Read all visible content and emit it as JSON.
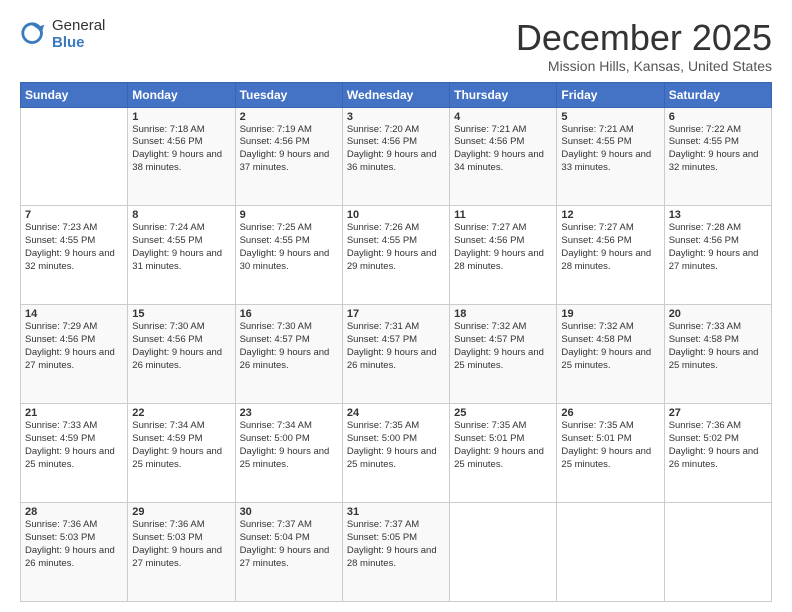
{
  "header": {
    "logo_general": "General",
    "logo_blue": "Blue",
    "month_title": "December 2025",
    "location": "Mission Hills, Kansas, United States"
  },
  "days_of_week": [
    "Sunday",
    "Monday",
    "Tuesday",
    "Wednesday",
    "Thursday",
    "Friday",
    "Saturday"
  ],
  "weeks": [
    [
      {
        "day": "",
        "sunrise": "",
        "sunset": "",
        "daylight": ""
      },
      {
        "day": "1",
        "sunrise": "Sunrise: 7:18 AM",
        "sunset": "Sunset: 4:56 PM",
        "daylight": "Daylight: 9 hours and 38 minutes."
      },
      {
        "day": "2",
        "sunrise": "Sunrise: 7:19 AM",
        "sunset": "Sunset: 4:56 PM",
        "daylight": "Daylight: 9 hours and 37 minutes."
      },
      {
        "day": "3",
        "sunrise": "Sunrise: 7:20 AM",
        "sunset": "Sunset: 4:56 PM",
        "daylight": "Daylight: 9 hours and 36 minutes."
      },
      {
        "day": "4",
        "sunrise": "Sunrise: 7:21 AM",
        "sunset": "Sunset: 4:56 PM",
        "daylight": "Daylight: 9 hours and 34 minutes."
      },
      {
        "day": "5",
        "sunrise": "Sunrise: 7:21 AM",
        "sunset": "Sunset: 4:55 PM",
        "daylight": "Daylight: 9 hours and 33 minutes."
      },
      {
        "day": "6",
        "sunrise": "Sunrise: 7:22 AM",
        "sunset": "Sunset: 4:55 PM",
        "daylight": "Daylight: 9 hours and 32 minutes."
      }
    ],
    [
      {
        "day": "7",
        "sunrise": "Sunrise: 7:23 AM",
        "sunset": "Sunset: 4:55 PM",
        "daylight": "Daylight: 9 hours and 32 minutes."
      },
      {
        "day": "8",
        "sunrise": "Sunrise: 7:24 AM",
        "sunset": "Sunset: 4:55 PM",
        "daylight": "Daylight: 9 hours and 31 minutes."
      },
      {
        "day": "9",
        "sunrise": "Sunrise: 7:25 AM",
        "sunset": "Sunset: 4:55 PM",
        "daylight": "Daylight: 9 hours and 30 minutes."
      },
      {
        "day": "10",
        "sunrise": "Sunrise: 7:26 AM",
        "sunset": "Sunset: 4:55 PM",
        "daylight": "Daylight: 9 hours and 29 minutes."
      },
      {
        "day": "11",
        "sunrise": "Sunrise: 7:27 AM",
        "sunset": "Sunset: 4:56 PM",
        "daylight": "Daylight: 9 hours and 28 minutes."
      },
      {
        "day": "12",
        "sunrise": "Sunrise: 7:27 AM",
        "sunset": "Sunset: 4:56 PM",
        "daylight": "Daylight: 9 hours and 28 minutes."
      },
      {
        "day": "13",
        "sunrise": "Sunrise: 7:28 AM",
        "sunset": "Sunset: 4:56 PM",
        "daylight": "Daylight: 9 hours and 27 minutes."
      }
    ],
    [
      {
        "day": "14",
        "sunrise": "Sunrise: 7:29 AM",
        "sunset": "Sunset: 4:56 PM",
        "daylight": "Daylight: 9 hours and 27 minutes."
      },
      {
        "day": "15",
        "sunrise": "Sunrise: 7:30 AM",
        "sunset": "Sunset: 4:56 PM",
        "daylight": "Daylight: 9 hours and 26 minutes."
      },
      {
        "day": "16",
        "sunrise": "Sunrise: 7:30 AM",
        "sunset": "Sunset: 4:57 PM",
        "daylight": "Daylight: 9 hours and 26 minutes."
      },
      {
        "day": "17",
        "sunrise": "Sunrise: 7:31 AM",
        "sunset": "Sunset: 4:57 PM",
        "daylight": "Daylight: 9 hours and 26 minutes."
      },
      {
        "day": "18",
        "sunrise": "Sunrise: 7:32 AM",
        "sunset": "Sunset: 4:57 PM",
        "daylight": "Daylight: 9 hours and 25 minutes."
      },
      {
        "day": "19",
        "sunrise": "Sunrise: 7:32 AM",
        "sunset": "Sunset: 4:58 PM",
        "daylight": "Daylight: 9 hours and 25 minutes."
      },
      {
        "day": "20",
        "sunrise": "Sunrise: 7:33 AM",
        "sunset": "Sunset: 4:58 PM",
        "daylight": "Daylight: 9 hours and 25 minutes."
      }
    ],
    [
      {
        "day": "21",
        "sunrise": "Sunrise: 7:33 AM",
        "sunset": "Sunset: 4:59 PM",
        "daylight": "Daylight: 9 hours and 25 minutes."
      },
      {
        "day": "22",
        "sunrise": "Sunrise: 7:34 AM",
        "sunset": "Sunset: 4:59 PM",
        "daylight": "Daylight: 9 hours and 25 minutes."
      },
      {
        "day": "23",
        "sunrise": "Sunrise: 7:34 AM",
        "sunset": "Sunset: 5:00 PM",
        "daylight": "Daylight: 9 hours and 25 minutes."
      },
      {
        "day": "24",
        "sunrise": "Sunrise: 7:35 AM",
        "sunset": "Sunset: 5:00 PM",
        "daylight": "Daylight: 9 hours and 25 minutes."
      },
      {
        "day": "25",
        "sunrise": "Sunrise: 7:35 AM",
        "sunset": "Sunset: 5:01 PM",
        "daylight": "Daylight: 9 hours and 25 minutes."
      },
      {
        "day": "26",
        "sunrise": "Sunrise: 7:35 AM",
        "sunset": "Sunset: 5:01 PM",
        "daylight": "Daylight: 9 hours and 25 minutes."
      },
      {
        "day": "27",
        "sunrise": "Sunrise: 7:36 AM",
        "sunset": "Sunset: 5:02 PM",
        "daylight": "Daylight: 9 hours and 26 minutes."
      }
    ],
    [
      {
        "day": "28",
        "sunrise": "Sunrise: 7:36 AM",
        "sunset": "Sunset: 5:03 PM",
        "daylight": "Daylight: 9 hours and 26 minutes."
      },
      {
        "day": "29",
        "sunrise": "Sunrise: 7:36 AM",
        "sunset": "Sunset: 5:03 PM",
        "daylight": "Daylight: 9 hours and 27 minutes."
      },
      {
        "day": "30",
        "sunrise": "Sunrise: 7:37 AM",
        "sunset": "Sunset: 5:04 PM",
        "daylight": "Daylight: 9 hours and 27 minutes."
      },
      {
        "day": "31",
        "sunrise": "Sunrise: 7:37 AM",
        "sunset": "Sunset: 5:05 PM",
        "daylight": "Daylight: 9 hours and 28 minutes."
      },
      {
        "day": "",
        "sunrise": "",
        "sunset": "",
        "daylight": ""
      },
      {
        "day": "",
        "sunrise": "",
        "sunset": "",
        "daylight": ""
      },
      {
        "day": "",
        "sunrise": "",
        "sunset": "",
        "daylight": ""
      }
    ]
  ]
}
